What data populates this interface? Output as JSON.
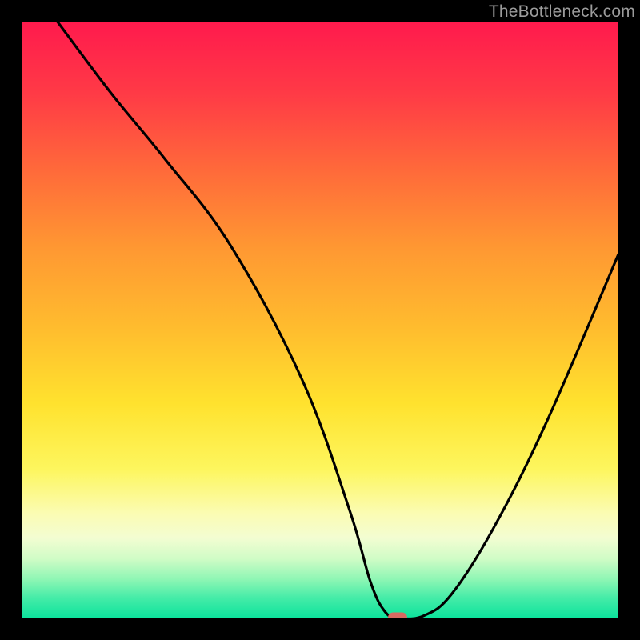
{
  "watermark": "TheBottleneck.com",
  "chart_data": {
    "type": "line",
    "title": "",
    "xlabel": "",
    "ylabel": "",
    "xlim": [
      0,
      100
    ],
    "ylim": [
      0,
      100
    ],
    "grid": false,
    "legend": false,
    "series": [
      {
        "name": "bottleneck-curve",
        "x": [
          6.0,
          15.0,
          24.0,
          35.0,
          47.0,
          55.0,
          58.5,
          61.0,
          63.5,
          67.5,
          72.0,
          79.0,
          88.0,
          100.0
        ],
        "y": [
          100.0,
          88.0,
          77.0,
          62.5,
          40.0,
          18.0,
          6.0,
          1.0,
          0.0,
          0.5,
          4.0,
          15.0,
          33.0,
          61.0
        ]
      }
    ],
    "marker": {
      "x": 63.0,
      "y": 0.0,
      "shape": "pill",
      "color": "#d86a62"
    },
    "background_gradient": {
      "stops": [
        {
          "pos": 0,
          "color": "#ff1a4d"
        },
        {
          "pos": 12,
          "color": "#ff3a46"
        },
        {
          "pos": 25,
          "color": "#ff6a3a"
        },
        {
          "pos": 38,
          "color": "#ff9832"
        },
        {
          "pos": 52,
          "color": "#ffbe2e"
        },
        {
          "pos": 64,
          "color": "#ffe22e"
        },
        {
          "pos": 75,
          "color": "#fdf65e"
        },
        {
          "pos": 82.5,
          "color": "#fbfcb4"
        },
        {
          "pos": 86.5,
          "color": "#f3fdd2"
        },
        {
          "pos": 90,
          "color": "#d0fcc6"
        },
        {
          "pos": 93.5,
          "color": "#8df6b4"
        },
        {
          "pos": 96.5,
          "color": "#46eca8"
        },
        {
          "pos": 100,
          "color": "#0be39c"
        }
      ]
    }
  }
}
